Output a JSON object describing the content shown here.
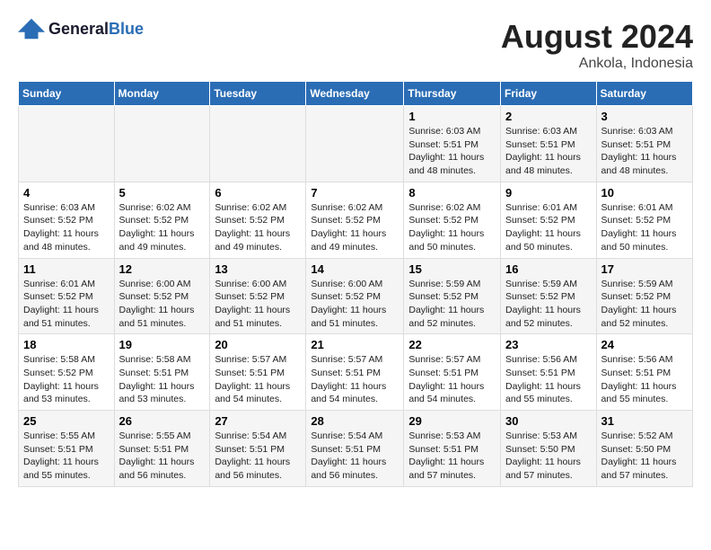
{
  "logo": {
    "text_general": "General",
    "text_blue": "Blue"
  },
  "header": {
    "month_year": "August 2024",
    "location": "Ankola, Indonesia"
  },
  "days_of_week": [
    "Sunday",
    "Monday",
    "Tuesday",
    "Wednesday",
    "Thursday",
    "Friday",
    "Saturday"
  ],
  "weeks": [
    [
      {
        "day": "",
        "content": ""
      },
      {
        "day": "",
        "content": ""
      },
      {
        "day": "",
        "content": ""
      },
      {
        "day": "",
        "content": ""
      },
      {
        "day": "1",
        "content": "Sunrise: 6:03 AM\nSunset: 5:51 PM\nDaylight: 11 hours\nand 48 minutes."
      },
      {
        "day": "2",
        "content": "Sunrise: 6:03 AM\nSunset: 5:51 PM\nDaylight: 11 hours\nand 48 minutes."
      },
      {
        "day": "3",
        "content": "Sunrise: 6:03 AM\nSunset: 5:51 PM\nDaylight: 11 hours\nand 48 minutes."
      }
    ],
    [
      {
        "day": "4",
        "content": "Sunrise: 6:03 AM\nSunset: 5:52 PM\nDaylight: 11 hours\nand 48 minutes."
      },
      {
        "day": "5",
        "content": "Sunrise: 6:02 AM\nSunset: 5:52 PM\nDaylight: 11 hours\nand 49 minutes."
      },
      {
        "day": "6",
        "content": "Sunrise: 6:02 AM\nSunset: 5:52 PM\nDaylight: 11 hours\nand 49 minutes."
      },
      {
        "day": "7",
        "content": "Sunrise: 6:02 AM\nSunset: 5:52 PM\nDaylight: 11 hours\nand 49 minutes."
      },
      {
        "day": "8",
        "content": "Sunrise: 6:02 AM\nSunset: 5:52 PM\nDaylight: 11 hours\nand 50 minutes."
      },
      {
        "day": "9",
        "content": "Sunrise: 6:01 AM\nSunset: 5:52 PM\nDaylight: 11 hours\nand 50 minutes."
      },
      {
        "day": "10",
        "content": "Sunrise: 6:01 AM\nSunset: 5:52 PM\nDaylight: 11 hours\nand 50 minutes."
      }
    ],
    [
      {
        "day": "11",
        "content": "Sunrise: 6:01 AM\nSunset: 5:52 PM\nDaylight: 11 hours\nand 51 minutes."
      },
      {
        "day": "12",
        "content": "Sunrise: 6:00 AM\nSunset: 5:52 PM\nDaylight: 11 hours\nand 51 minutes."
      },
      {
        "day": "13",
        "content": "Sunrise: 6:00 AM\nSunset: 5:52 PM\nDaylight: 11 hours\nand 51 minutes."
      },
      {
        "day": "14",
        "content": "Sunrise: 6:00 AM\nSunset: 5:52 PM\nDaylight: 11 hours\nand 51 minutes."
      },
      {
        "day": "15",
        "content": "Sunrise: 5:59 AM\nSunset: 5:52 PM\nDaylight: 11 hours\nand 52 minutes."
      },
      {
        "day": "16",
        "content": "Sunrise: 5:59 AM\nSunset: 5:52 PM\nDaylight: 11 hours\nand 52 minutes."
      },
      {
        "day": "17",
        "content": "Sunrise: 5:59 AM\nSunset: 5:52 PM\nDaylight: 11 hours\nand 52 minutes."
      }
    ],
    [
      {
        "day": "18",
        "content": "Sunrise: 5:58 AM\nSunset: 5:52 PM\nDaylight: 11 hours\nand 53 minutes."
      },
      {
        "day": "19",
        "content": "Sunrise: 5:58 AM\nSunset: 5:51 PM\nDaylight: 11 hours\nand 53 minutes."
      },
      {
        "day": "20",
        "content": "Sunrise: 5:57 AM\nSunset: 5:51 PM\nDaylight: 11 hours\nand 54 minutes."
      },
      {
        "day": "21",
        "content": "Sunrise: 5:57 AM\nSunset: 5:51 PM\nDaylight: 11 hours\nand 54 minutes."
      },
      {
        "day": "22",
        "content": "Sunrise: 5:57 AM\nSunset: 5:51 PM\nDaylight: 11 hours\nand 54 minutes."
      },
      {
        "day": "23",
        "content": "Sunrise: 5:56 AM\nSunset: 5:51 PM\nDaylight: 11 hours\nand 55 minutes."
      },
      {
        "day": "24",
        "content": "Sunrise: 5:56 AM\nSunset: 5:51 PM\nDaylight: 11 hours\nand 55 minutes."
      }
    ],
    [
      {
        "day": "25",
        "content": "Sunrise: 5:55 AM\nSunset: 5:51 PM\nDaylight: 11 hours\nand 55 minutes."
      },
      {
        "day": "26",
        "content": "Sunrise: 5:55 AM\nSunset: 5:51 PM\nDaylight: 11 hours\nand 56 minutes."
      },
      {
        "day": "27",
        "content": "Sunrise: 5:54 AM\nSunset: 5:51 PM\nDaylight: 11 hours\nand 56 minutes."
      },
      {
        "day": "28",
        "content": "Sunrise: 5:54 AM\nSunset: 5:51 PM\nDaylight: 11 hours\nand 56 minutes."
      },
      {
        "day": "29",
        "content": "Sunrise: 5:53 AM\nSunset: 5:51 PM\nDaylight: 11 hours\nand 57 minutes."
      },
      {
        "day": "30",
        "content": "Sunrise: 5:53 AM\nSunset: 5:50 PM\nDaylight: 11 hours\nand 57 minutes."
      },
      {
        "day": "31",
        "content": "Sunrise: 5:52 AM\nSunset: 5:50 PM\nDaylight: 11 hours\nand 57 minutes."
      }
    ]
  ]
}
